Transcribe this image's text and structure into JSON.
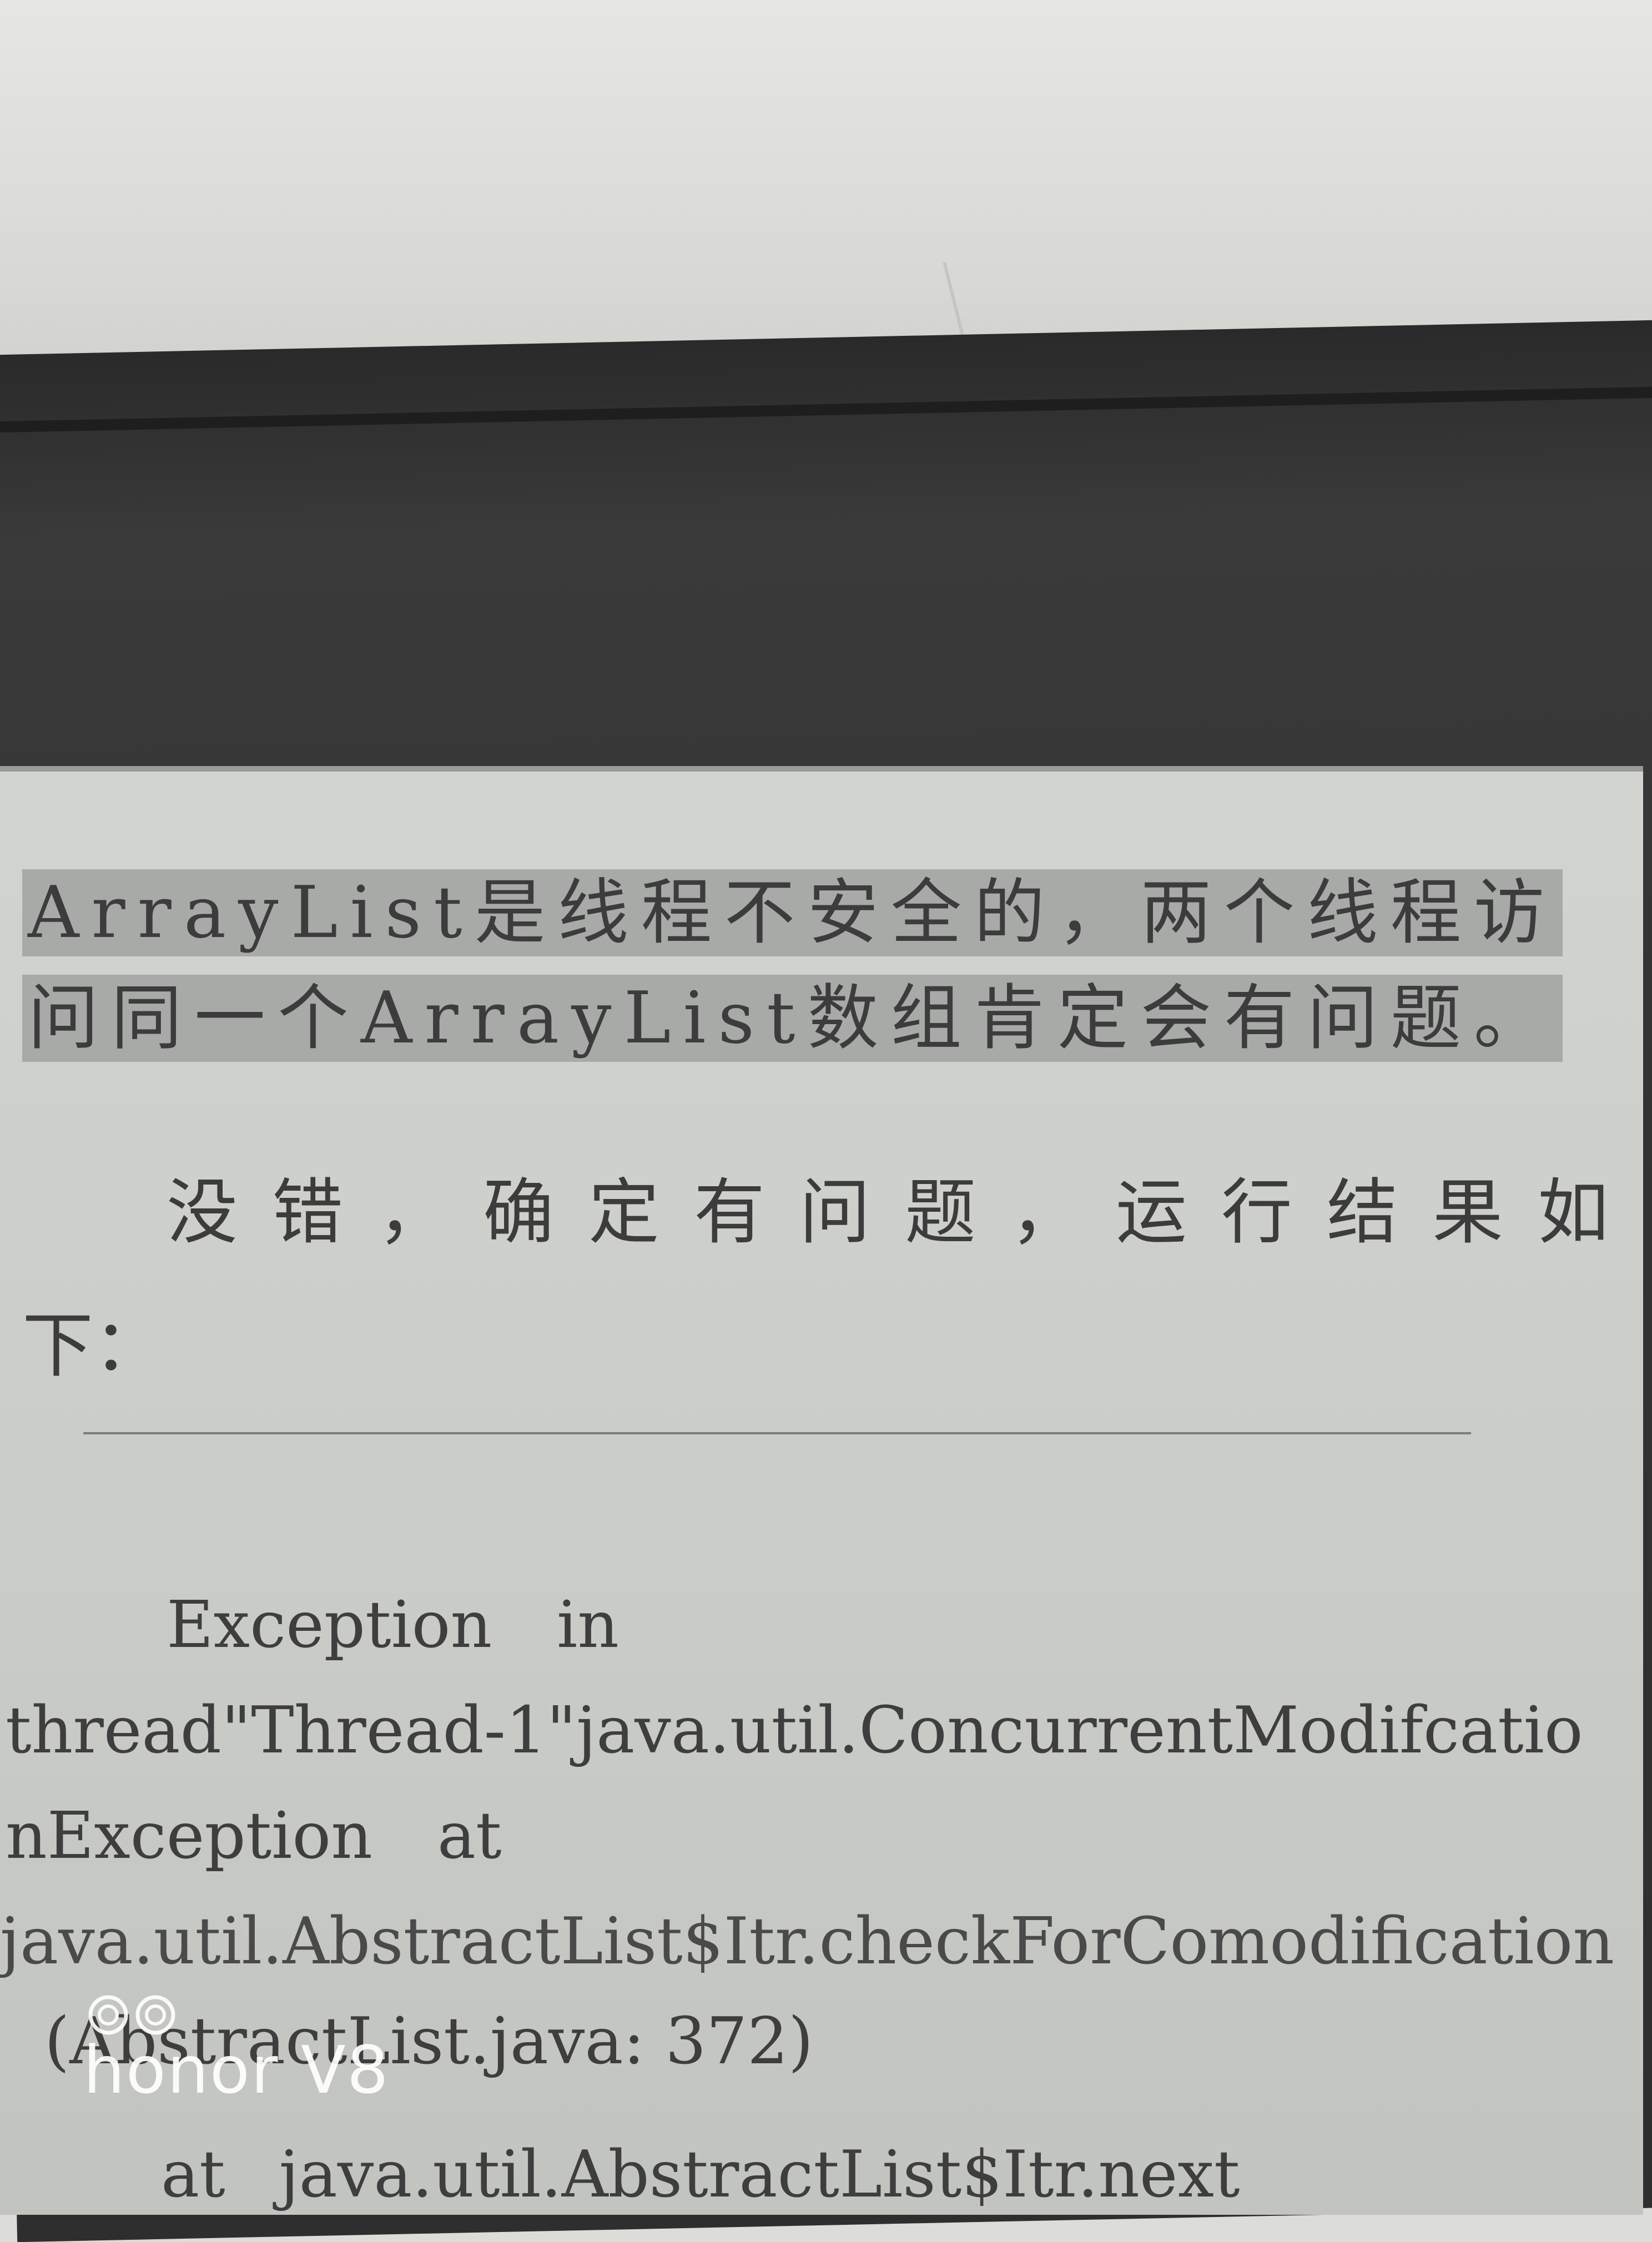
{
  "page": {
    "highlighted_line_1": "ArrayList是线程不安全的，两个线程访",
    "highlighted_line_2": "问同一个ArrayList数组肯定会有问题。",
    "body_line_1": "没错，确定有问题，运行结果如",
    "body_line_2": "下："
  },
  "code_block": {
    "line_1": "Exception in",
    "line_2": "thread\"Thread-1\"java.util.ConcurrentModifcatio",
    "line_3": "nException at",
    "line_4": "java.util.AbstractList$Itr.checkForComodification",
    "line_5": "(AbstractList.java: 372)",
    "line_6": "at java.util.AbstractList$Itr.next"
  },
  "watermark": {
    "text": "honor V8"
  },
  "colors": {
    "highlight": "#a8aaa8",
    "screen": "#cbcdc9",
    "bezel": "#333333",
    "text": "#3c3c3c"
  }
}
